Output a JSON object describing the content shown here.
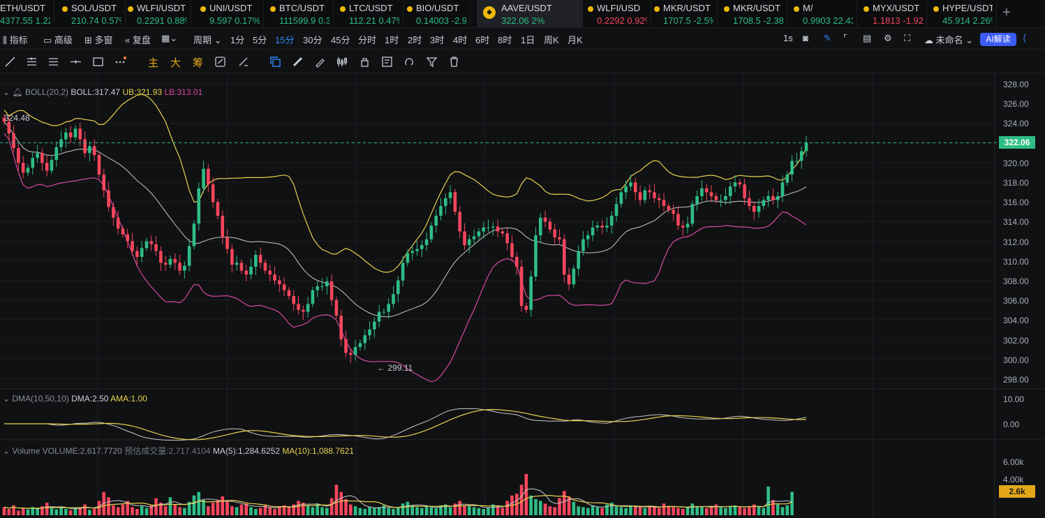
{
  "tabs": [
    {
      "symbol": "ETH/USDT",
      "price": "4377.55",
      "change": "1.22",
      "dir": "up"
    },
    {
      "symbol": "SOL/USDT",
      "price": "210.74",
      "change": "0.57%",
      "dir": "up"
    },
    {
      "symbol": "WLFI/USDT",
      "price": "0.2291",
      "change": "0.88%",
      "dir": "up"
    },
    {
      "symbol": "UNI/USDT",
      "price": "9.597",
      "change": "0.17%",
      "dir": "up"
    },
    {
      "symbol": "BTC/USDT",
      "price": "111599.9",
      "change": "0.3",
      "dir": "up"
    },
    {
      "symbol": "LTC/USDT",
      "price": "112.21",
      "change": "0.47%",
      "dir": "up"
    },
    {
      "symbol": "BIO/USDT",
      "price": "0.14003",
      "change": "-2.9",
      "dir": "up"
    },
    {
      "symbol": "AAVE/USDT",
      "price": "322.06",
      "change": "2%",
      "dir": "up"
    },
    {
      "symbol": "WLFI/USD",
      "price": "0.2292",
      "change": "0.92%",
      "dir": "down"
    },
    {
      "symbol": "MKR/USDT",
      "price": "1707.5",
      "change": "-2.5%",
      "dir": "up"
    },
    {
      "symbol": "MKR/USDT",
      "price": "1708.5",
      "change": "-2.38",
      "dir": "up"
    },
    {
      "symbol": "M/",
      "price": "0.9903",
      "change": "22.43",
      "dir": "up"
    },
    {
      "symbol": "MYX/USDT",
      "price": "1.1813",
      "change": "-1.92",
      "dir": "down"
    },
    {
      "symbol": "HYPE/USDT",
      "price": "45.914",
      "change": "2.26%",
      "dir": "up"
    }
  ],
  "toolbar": {
    "indicators": "指标",
    "advanced": "高级",
    "multi": "多窗",
    "replay": "复盘",
    "period": "周期",
    "intervals": [
      "1分",
      "5分",
      "15分",
      "30分",
      "45分",
      "分时",
      "1时",
      "2时",
      "3时",
      "4时",
      "6时",
      "8时",
      "1日",
      "周K",
      "月K"
    ],
    "selected_interval": "15分",
    "right": {
      "sec": "1s",
      "name": "未命名",
      "ai": "AI解读"
    }
  },
  "drawing_labels": {
    "main": "主",
    "big": "大",
    "chips": "筹"
  },
  "boll": {
    "title": "BOLL(20,2)",
    "boll": "BOLL:317.47",
    "ub": "UB:321.93",
    "lb": "LB:313.01"
  },
  "dma": {
    "title": "DMA(10,50,10)",
    "dma": "DMA:2.50",
    "ama": "AMA:1.00"
  },
  "volume": {
    "title": "Volume",
    "vol": "VOLUME:2,617.7720",
    "est": "预估成交量:2,717.4104",
    "ma5": "MA(5):1,284.6252",
    "ma10": "MA(10):1,088.7621"
  },
  "price_axis": [
    "328.00",
    "326.00",
    "324.00",
    "322.00",
    "320.00",
    "318.00",
    "316.00",
    "314.00",
    "312.00",
    "310.00",
    "308.00",
    "306.00",
    "304.00",
    "302.00",
    "300.00",
    "298.00"
  ],
  "dma_axis": [
    "10.00",
    "0.00"
  ],
  "vol_axis": [
    "6.00k",
    "4.00k"
  ],
  "labels": {
    "high": "324.48",
    "low": "299.11",
    "last_price": "322.06",
    "last_vol": "2.6k"
  },
  "colors": {
    "up": "#2ebd85",
    "down": "#f6465d",
    "ub": "#e8d44d",
    "lb": "#d94aa5",
    "mid": "#c8c8c8",
    "accent": "#2f8cff"
  },
  "chart_data": {
    "type": "candlestick",
    "price_range": [
      297,
      329
    ],
    "closes": [
      324.2,
      323.0,
      321.5,
      320.0,
      319.0,
      319.5,
      320.5,
      321.0,
      320.0,
      319.2,
      320.3,
      321.6,
      322.4,
      323.1,
      322.6,
      323.5,
      322.4,
      321.0,
      321.7,
      320.8,
      318.8,
      317.2,
      315.5,
      314.4,
      313.3,
      312.7,
      312.0,
      311.0,
      310.4,
      311.3,
      312.0,
      311.7,
      311.0,
      309.8,
      309.6,
      310.2,
      309.8,
      309.0,
      309.5,
      311.5,
      313.8,
      317.4,
      319.4,
      317.8,
      316.0,
      314.6,
      312.4,
      311.2,
      309.6,
      309.8,
      309.0,
      308.6,
      309.4,
      310.6,
      309.8,
      309.0,
      308.6,
      308.0,
      307.6,
      307.0,
      306.4,
      305.6,
      305.0,
      304.8,
      305.6,
      307.0,
      307.4,
      307.4,
      307.9,
      306.0,
      304.4,
      302.0,
      300.6,
      300.4,
      301.2,
      301.6,
      302.4,
      303.0,
      303.8,
      304.8,
      304.8,
      305.6,
      306.6,
      308.0,
      309.8,
      310.8,
      311.0,
      311.2,
      311.6,
      312.2,
      313.6,
      314.6,
      315.6,
      316.4,
      317.0,
      315.0,
      313.0,
      311.6,
      312.2,
      312.5,
      313.0,
      313.4,
      313.4,
      313.5,
      313.0,
      312.8,
      311.8,
      310.4,
      309.4,
      305.4,
      305.0,
      308.4,
      312.6,
      314.4,
      314.0,
      313.2,
      312.4,
      312.2,
      308.6,
      307.6,
      309.2,
      311.0,
      312.2,
      312.6,
      313.4,
      313.6,
      313.4,
      313.6,
      314.6,
      315.8,
      317.0,
      317.6,
      318.0,
      317.0,
      316.2,
      317.2,
      317.0,
      316.4,
      316.2,
      315.6,
      315.2,
      314.8,
      313.6,
      313.4,
      313.8,
      315.8,
      316.6,
      317.4,
      317.0,
      316.6,
      316.2,
      316.2,
      316.6,
      317.6,
      318.0,
      317.8,
      316.4,
      315.6,
      315.0,
      315.6,
      316.2,
      316.6,
      316.2,
      316.6,
      318.0,
      318.8,
      320.2,
      320.2,
      321.2,
      322.06
    ],
    "volumes": [
      900,
      700,
      1100,
      500,
      800,
      650,
      900,
      700,
      1000,
      1400,
      800,
      650,
      900,
      700,
      550,
      800,
      900,
      1200,
      600,
      700,
      1600,
      2600,
      2000,
      1100,
      900,
      1200,
      1600,
      900,
      700,
      1000,
      800,
      1100,
      1900,
      1400,
      1000,
      2000,
      1200,
      900,
      800,
      1500,
      2200,
      2600,
      1700,
      1000,
      1400,
      1700,
      2100,
      1500,
      1000,
      900,
      1200,
      1300,
      900,
      700,
      800,
      1100,
      900,
      700,
      1000,
      1100,
      900,
      1200,
      1600,
      1400,
      1100,
      900,
      1300,
      900,
      800,
      1900,
      3400,
      2600,
      1800,
      1200,
      1000,
      800,
      700,
      900,
      800,
      900,
      1100,
      800,
      700,
      900,
      1300,
      1500,
      1100,
      900,
      800,
      1000,
      900,
      800,
      1100,
      1200,
      900,
      1300,
      1600,
      1100,
      1000,
      900,
      800,
      700,
      900,
      1200,
      1000,
      800,
      1600,
      2200,
      2400,
      3400,
      4600,
      2200,
      1800,
      1600,
      1300,
      1000,
      900,
      1900,
      2700,
      2100,
      1500,
      1000,
      900,
      800,
      1100,
      900,
      800,
      1200,
      1400,
      1000,
      900,
      800,
      1100,
      1000,
      900,
      800,
      1000,
      900,
      800,
      1300,
      1000,
      900,
      800,
      700,
      900,
      1300,
      1000,
      900,
      800,
      1000,
      1200,
      900,
      800,
      1000,
      1100,
      900,
      800,
      1000,
      1200,
      900,
      800,
      3200,
      1700,
      1200,
      900,
      1100,
      2617.77
    ]
  }
}
